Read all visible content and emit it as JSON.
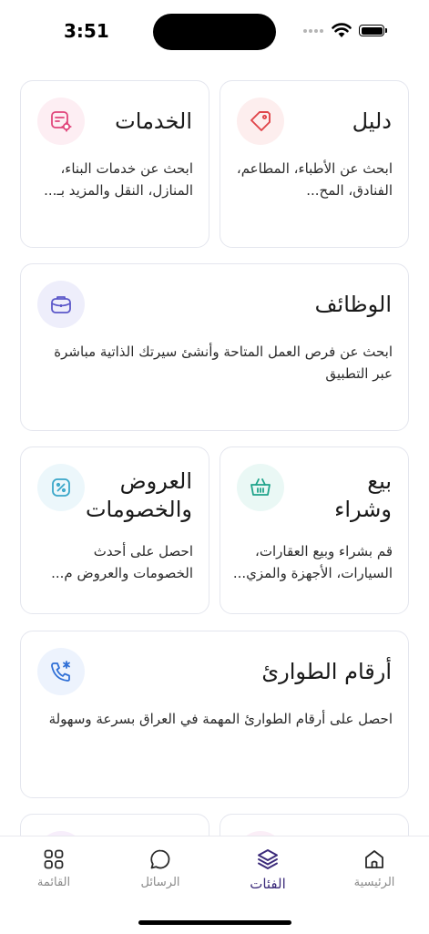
{
  "status": {
    "time": "3:51"
  },
  "cards": {
    "services": {
      "title": "الخدمات",
      "desc": "ابحث عن خدمات البناء، المنازل، النقل والمزيد بـ...",
      "icon": "service-settings-icon",
      "accent": "#e0457b"
    },
    "directory": {
      "title": "دليل",
      "desc": "ابحث عن الأطباء، المطاعم، الفنادق، المح...",
      "icon": "tag-icon",
      "accent": "#e0454a"
    },
    "jobs": {
      "title": "الوظائف",
      "desc": "ابحث عن فرص العمل المتاحة وأنشئ سيرتك الذاتية مباشرة عبر التطبيق",
      "icon": "briefcase-icon",
      "accent": "#5b57c9"
    },
    "offers": {
      "title": "العروض\nوالخصومات",
      "desc": "احصل على أحدث الخصومات والعروض م...",
      "icon": "discount-icon",
      "accent": "#3aa7c9"
    },
    "buysell": {
      "title": "بيع\nوشراء",
      "desc": "قم بشراء وبيع العقارات، السيارات، الأجهزة والمزي...",
      "icon": "basket-icon",
      "accent": "#1fa38a"
    },
    "emergency": {
      "title": "أرقام الطوارئ",
      "desc": "احصل على أرقام الطوارئ المهمة في العراق بسرعة وسهولة",
      "icon": "emergency-phone-icon",
      "accent": "#2f6fd6"
    }
  },
  "nav": {
    "home": "الرئيسية",
    "categories": "الفئات",
    "messages": "الرسائل",
    "menu": "القائمة"
  },
  "colors": {
    "active_nav": "#3b2a7a",
    "inactive_nav": "#8a8a8a",
    "card_border": "#e4e6ee"
  }
}
